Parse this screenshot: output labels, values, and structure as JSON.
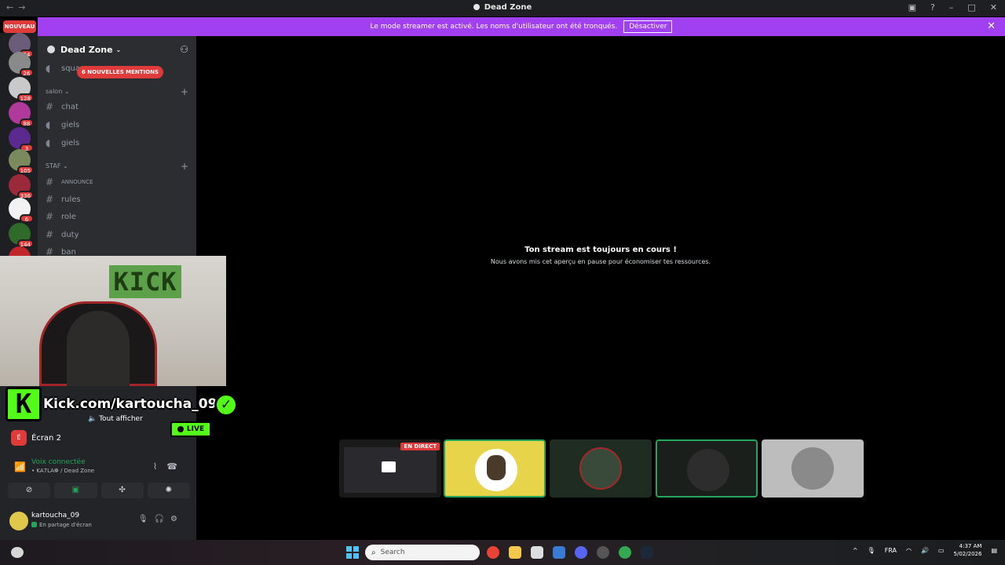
{
  "window": {
    "title": "Dead Zone",
    "nav_back": "←",
    "nav_forward": "→"
  },
  "banner": {
    "text": "Le mode streamer est activé. Les noms d'utilisateur ont été tronqués.",
    "button": "Désactiver",
    "close": "✕"
  },
  "server_rail": {
    "nouveau": "NOUVEAU",
    "badges": [
      "64",
      "26",
      "128",
      "88",
      "3",
      "105",
      "336",
      "6",
      "144"
    ]
  },
  "guild": {
    "name": "Dead Zone",
    "mentions_pill": "6 NOUVELLES MENTIONS",
    "top_channel": "squa...",
    "categories": [
      {
        "name": "salon",
        "channels": [
          "chat",
          "giels",
          "giels"
        ]
      },
      {
        "name": "STAF",
        "channels": [
          "ANNOUNCE",
          "rules",
          "role",
          "duty",
          "ban"
        ]
      }
    ]
  },
  "main": {
    "stream_title": "Ton stream est toujours en cours !",
    "stream_subtitle": "Nous avons mis cet aperçu en pause pour économiser tes ressources.",
    "en_direct": "EN DIRECT"
  },
  "overlay": {
    "kick_logo": "KICK",
    "kick_url": "Kick.com/kartoucha_09",
    "k_letter": "K",
    "check": "✓",
    "live": "LIVE"
  },
  "voice_panel": {
    "tout_afficher": "Tout afficher",
    "screen_label": "Écran 2",
    "voice_connected": "Voix connectée",
    "voice_sub": "• KA7LA❁ / Dead Zone"
  },
  "user": {
    "name": "kartoucha_09",
    "status": "En partage d'écran"
  },
  "taskbar": {
    "search_placeholder": "Search",
    "lang": "FRA",
    "time": "4:37 AM",
    "date": "5/02/2026"
  },
  "colors": {
    "accent": "#a140f0",
    "kick_green": "#53fc18",
    "danger": "#e03b3b",
    "online": "#23a55a"
  }
}
